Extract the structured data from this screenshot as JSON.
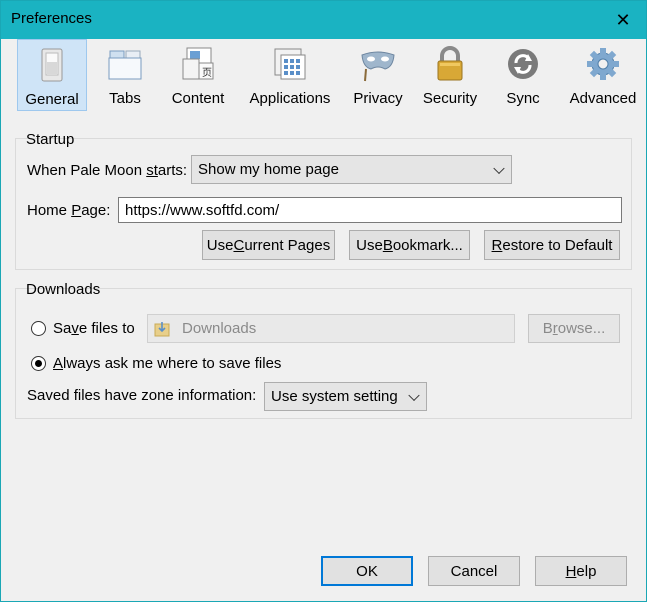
{
  "window": {
    "title": "Preferences",
    "close_glyph": "✕"
  },
  "toolbar": {
    "items": [
      {
        "label": "General",
        "icon": "general-icon",
        "active": true
      },
      {
        "label": "Tabs",
        "icon": "tabs-icon"
      },
      {
        "label": "Content",
        "icon": "content-icon"
      },
      {
        "label": "Applications",
        "icon": "applications-icon"
      },
      {
        "label": "Privacy",
        "icon": "privacy-mask-icon"
      },
      {
        "label": "Security",
        "icon": "padlock-icon"
      },
      {
        "label": "Sync",
        "icon": "sync-icon"
      },
      {
        "label": "Advanced",
        "icon": "gear-icon"
      }
    ]
  },
  "startup": {
    "group_label": "Startup",
    "starts_label_prefix": "When Pale Moon ",
    "starts_label_underline": "st",
    "starts_label_suffix": "arts:",
    "starts_value": "Show my home page",
    "homepage_label_prefix": "Home ",
    "homepage_label_underline": "P",
    "homepage_label_suffix": "age:",
    "homepage_value": "https://www.softfd.com/",
    "btn_current_prefix": "Use ",
    "btn_current_underline": "C",
    "btn_current_suffix": "urrent Pages",
    "btn_bookmark_prefix": "Use ",
    "btn_bookmark_underline": "B",
    "btn_bookmark_suffix": "ookmark...",
    "btn_restore_prefix": "",
    "btn_restore_underline": "R",
    "btn_restore_suffix": "estore to Default"
  },
  "downloads": {
    "group_label": "Downloads",
    "save_to_prefix": "Sa",
    "save_to_underline": "v",
    "save_to_suffix": "e files to",
    "folder_value": "Downloads",
    "browse_prefix": "B",
    "browse_underline": "r",
    "browse_suffix": "owse...",
    "always_ask_prefix": "",
    "always_ask_underline": "A",
    "always_ask_suffix": "lways ask me where to save files",
    "zone_label": "Saved files have zone information:",
    "zone_value": "Use system setting"
  },
  "footer": {
    "ok": "OK",
    "cancel": "Cancel",
    "help_underline": "H",
    "help_suffix": "elp"
  }
}
